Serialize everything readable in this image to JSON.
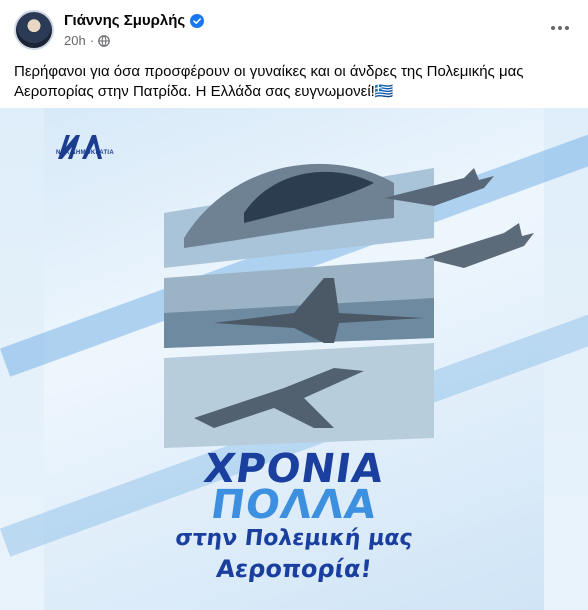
{
  "post": {
    "author": "Γιάννης Σμυρλής",
    "time": "20h",
    "text": "Περήφανοι για όσα προσφέρουν οι γυναίκες και οι άνδρες της Πολεμικής μας Αεροπορίας στην Πατρίδα. Η Ελλάδα σας ευγνωμονεί!🇬🇷"
  },
  "image": {
    "logo_text": "ΝΕΑ ΔΗΜΟΚΡΑΤΙΑ",
    "line1": "ΧΡΟΝΙΑ",
    "line2": "ΠΟΛΛΑ",
    "line3": "στην Πολεμική μας",
    "line4": "Αεροπορία!"
  },
  "colors": {
    "verified": "#1877f2",
    "brand_dark": "#1a3f9e",
    "brand_light": "#3d8fe0"
  }
}
